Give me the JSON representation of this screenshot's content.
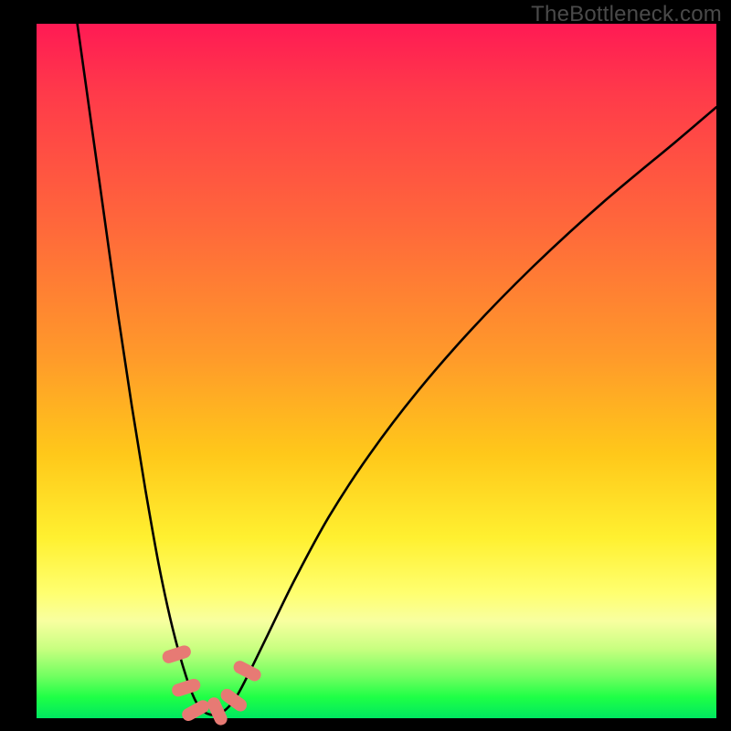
{
  "watermark": "TheBottleneck.com",
  "chart_data": {
    "type": "line",
    "title": "",
    "xlabel": "",
    "ylabel": "",
    "xlim": [
      0,
      100
    ],
    "ylim": [
      0,
      100
    ],
    "series": [
      {
        "name": "bottleneck-curve",
        "x": [
          6,
          8,
          10,
          12,
          14,
          16,
          18,
          20,
          22,
          23.5,
          25,
          27,
          29,
          31,
          34,
          38,
          43,
          49,
          56,
          64,
          73,
          83,
          94,
          100
        ],
        "values": [
          100,
          86,
          72,
          58,
          45,
          33,
          22,
          13,
          6,
          2.3,
          0.7,
          0.7,
          2.5,
          6,
          12,
          20,
          29,
          38,
          47,
          56,
          65,
          74,
          83,
          88
        ]
      }
    ],
    "markers": [
      {
        "name": "marker-a",
        "x": 20.6,
        "y": 9.2
      },
      {
        "name": "marker-b",
        "x": 22.0,
        "y": 4.4
      },
      {
        "name": "marker-c",
        "x": 23.4,
        "y": 1.1
      },
      {
        "name": "marker-d",
        "x": 26.6,
        "y": 1.0
      },
      {
        "name": "marker-e",
        "x": 29.0,
        "y": 2.6
      },
      {
        "name": "marker-f",
        "x": 31.0,
        "y": 6.8
      }
    ],
    "gradient_stops": [
      {
        "pos": 0,
        "color": "#ff1a54"
      },
      {
        "pos": 30,
        "color": "#ff6a3a"
      },
      {
        "pos": 62,
        "color": "#ffc81a"
      },
      {
        "pos": 82,
        "color": "#ffff70"
      },
      {
        "pos": 100,
        "color": "#00e860"
      }
    ]
  }
}
